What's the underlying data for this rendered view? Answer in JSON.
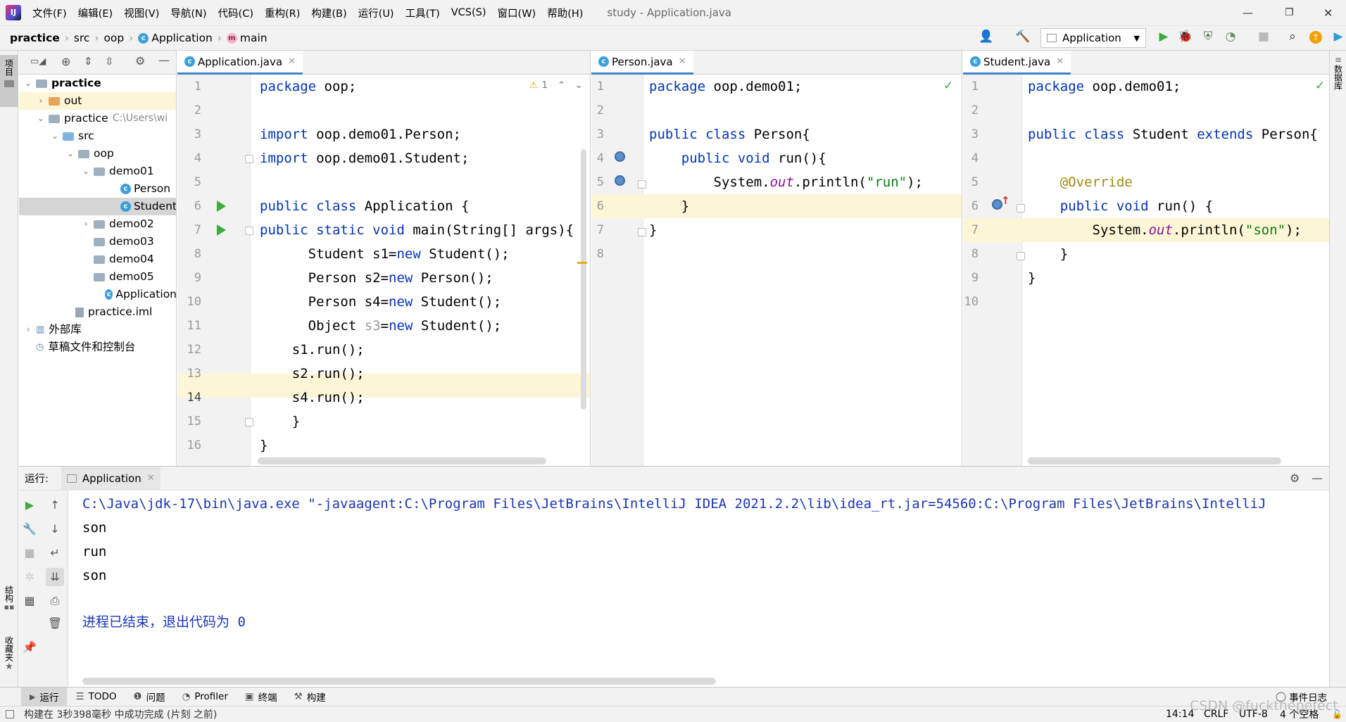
{
  "menubar": {
    "items": [
      "文件(F)",
      "编辑(E)",
      "视图(V)",
      "导航(N)",
      "代码(C)",
      "重构(R)",
      "构建(B)",
      "运行(U)",
      "工具(T)",
      "VCS(S)",
      "窗口(W)",
      "帮助(H)"
    ],
    "window_title": "study - Application.java",
    "minimize": "—",
    "restore": "❐",
    "close": "✕"
  },
  "navbar": {
    "crumbs": [
      "practice",
      "src",
      "oop",
      "Application",
      "main"
    ],
    "run_config": "Application"
  },
  "sidebar_left": {
    "project_label": "项目",
    "structure_label": "结构",
    "favorites_label": "收藏夹"
  },
  "sidebar_right": {
    "db_label": "数据库"
  },
  "project_tree": {
    "items": [
      {
        "label": "practice",
        "extra": ""
      },
      {
        "label": "out",
        "extra": ""
      },
      {
        "label": "practice",
        "extra": "C:\\Users\\wi"
      },
      {
        "label": "src",
        "extra": ""
      },
      {
        "label": "oop",
        "extra": ""
      },
      {
        "label": "demo01",
        "extra": ""
      },
      {
        "label": "Person",
        "extra": ""
      },
      {
        "label": "Student",
        "extra": ""
      },
      {
        "label": "demo02",
        "extra": ""
      },
      {
        "label": "demo03",
        "extra": ""
      },
      {
        "label": "demo04",
        "extra": ""
      },
      {
        "label": "demo05",
        "extra": ""
      },
      {
        "label": "Application",
        "extra": ""
      },
      {
        "label": "practice.iml",
        "extra": ""
      },
      {
        "label": "外部库",
        "extra": ""
      },
      {
        "label": "草稿文件和控制台",
        "extra": ""
      }
    ]
  },
  "editors": [
    {
      "tab": "Application.java",
      "warning_count": "1",
      "line_numbers": [
        "1",
        "2",
        "3",
        "4",
        "5",
        "6",
        "7",
        "8",
        "9",
        "10",
        "11",
        "12",
        "13",
        "14",
        "15",
        "16"
      ]
    },
    {
      "tab": "Person.java",
      "line_numbers": [
        "1",
        "2",
        "3",
        "4",
        "5",
        "6",
        "7",
        "8"
      ]
    },
    {
      "tab": "Student.java",
      "line_numbers": [
        "1",
        "2",
        "3",
        "4",
        "5",
        "6",
        "7",
        "8",
        "9",
        "10"
      ]
    }
  ],
  "run_panel": {
    "label": "运行:",
    "tab": "Application",
    "console": [
      "C:\\Java\\jdk-17\\bin\\java.exe \"-javaagent:C:\\Program Files\\JetBrains\\IntelliJ IDEA 2021.2.2\\lib\\idea_rt.jar=54560:C:\\Program Files\\JetBrains\\IntelliJ",
      "son",
      "run",
      "son",
      "",
      "进程已结束，退出代码为 0"
    ]
  },
  "bottom_tabs": [
    "运行",
    "TODO",
    "问题",
    "Profiler",
    "终端",
    "构建"
  ],
  "event_log": "事件日志",
  "status": {
    "message": "构建在 3秒398毫秒 中成功完成 (片刻 之前)",
    "position": "14:14",
    "line_sep": "CRLF",
    "encoding": "UTF-8",
    "indent": "4 个空格"
  },
  "watermark": "CSDN @fuckthepefect",
  "colors": {
    "keyword": "#0033b3",
    "string": "#067d17",
    "field": "#871094",
    "annotation": "#9e880d",
    "console_path": "#1a35b5"
  }
}
